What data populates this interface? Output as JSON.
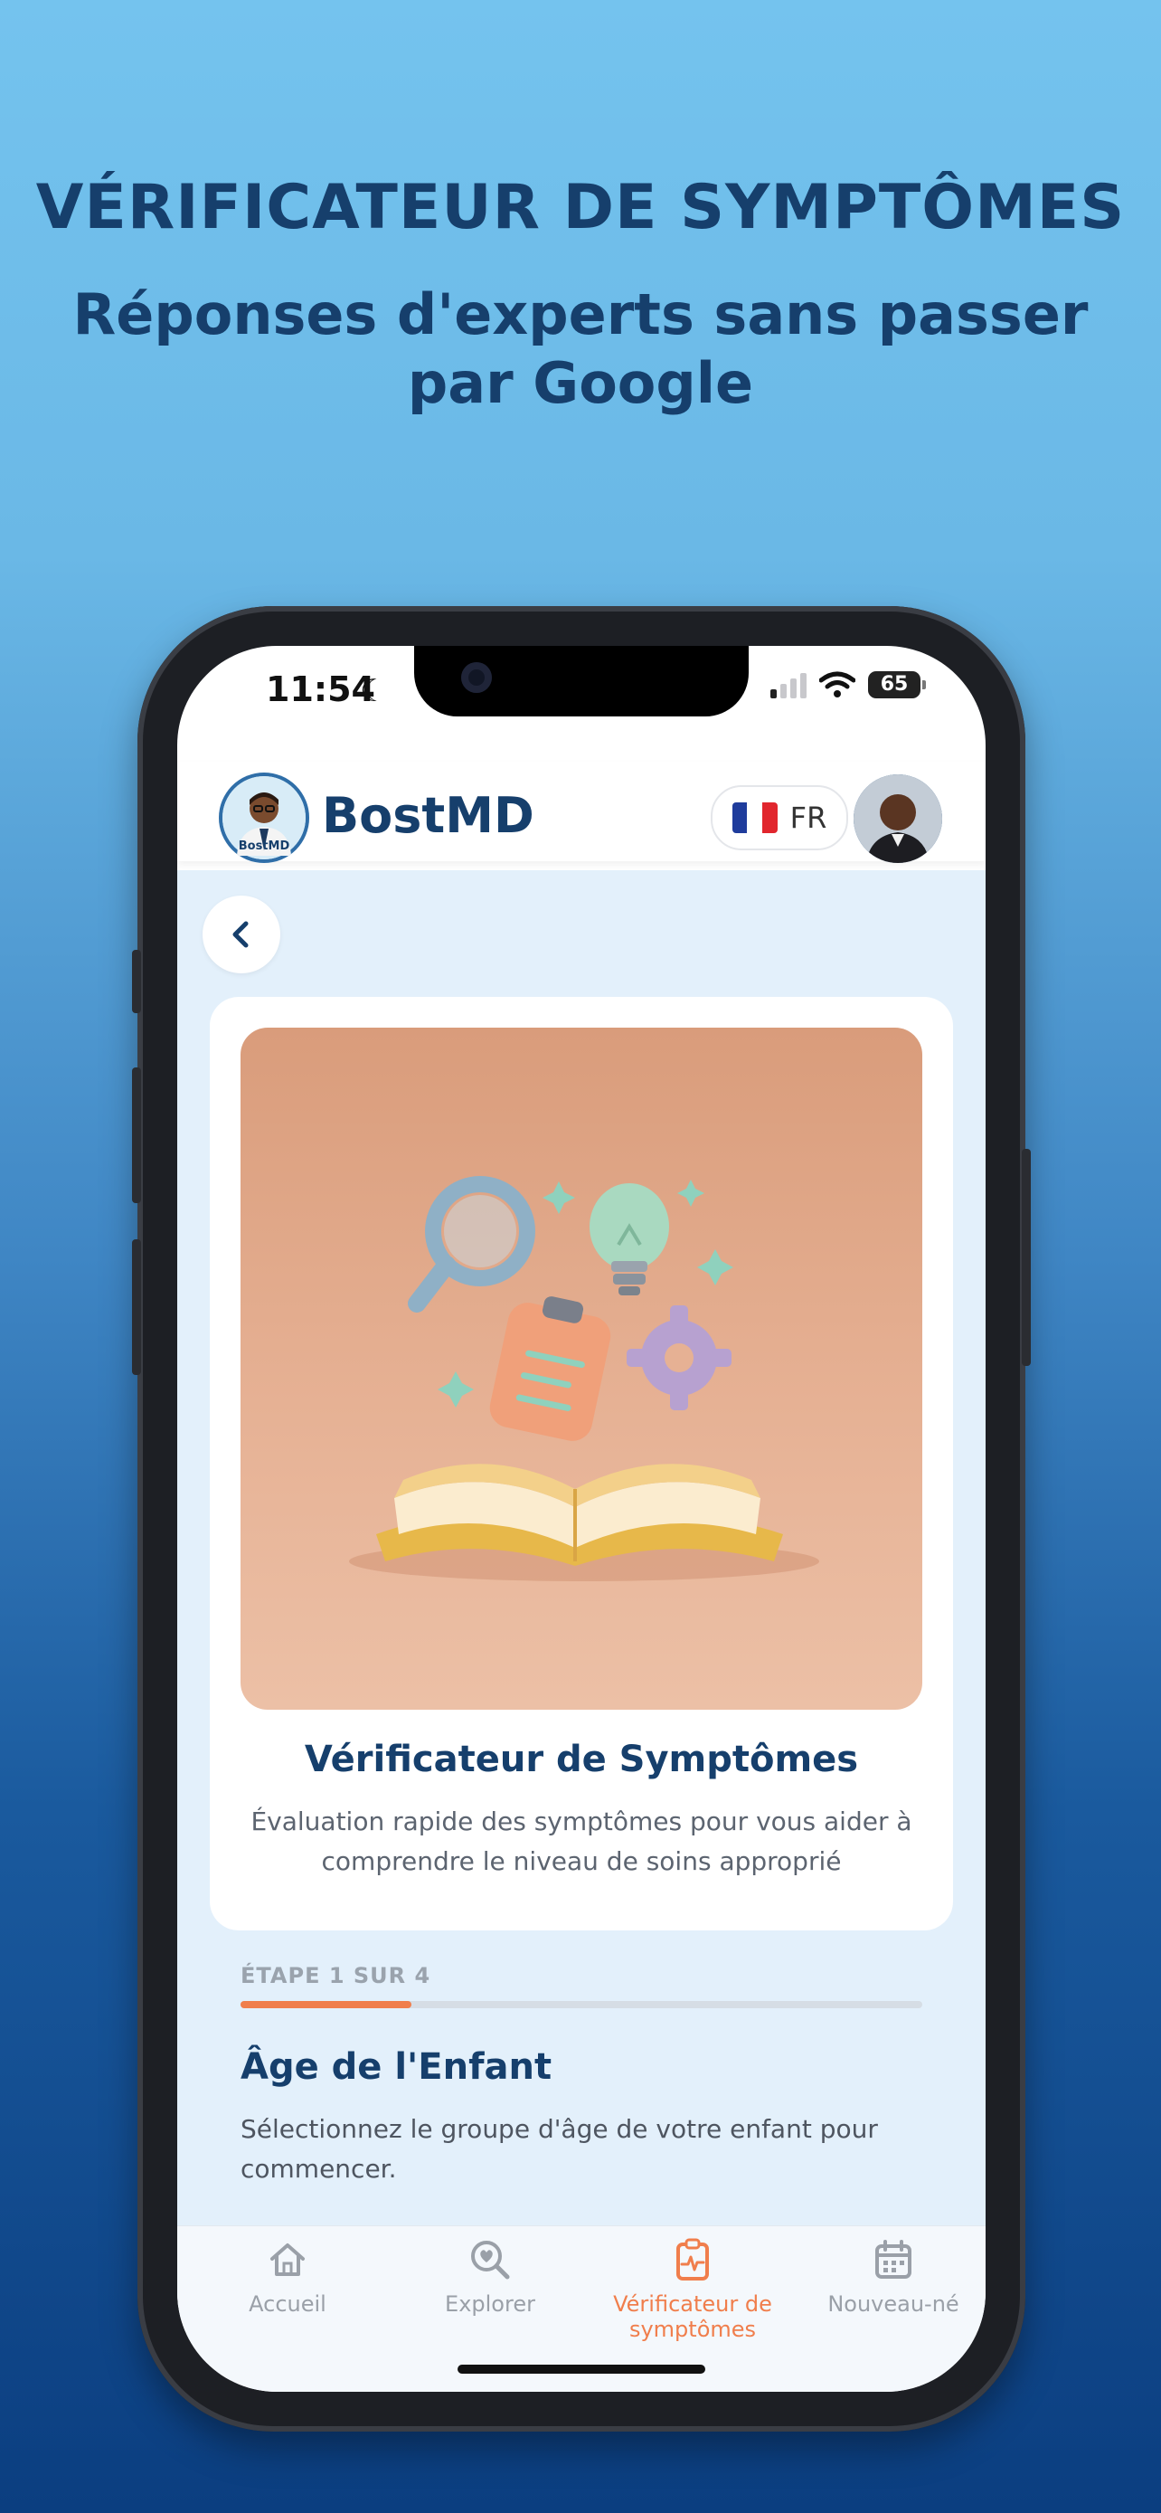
{
  "promo": {
    "headline": "VÉRIFICATEUR DE SYMPTÔMES",
    "subheadline": "Réponses d'experts sans passer par Google"
  },
  "status_bar": {
    "time": "11:54",
    "battery": "65"
  },
  "header": {
    "brand": "BostMD",
    "logo_caption": "BostMD",
    "language_code": "FR"
  },
  "card": {
    "title": "Vérificateur de Symptômes",
    "description": "Évaluation rapide des symptômes pour vous aider à comprendre le niveau de soins approprié"
  },
  "step": {
    "label": "ÉTAPE 1 SUR 4",
    "progress_fraction": 0.25
  },
  "section": {
    "title": "Âge de l'Enfant",
    "description": "Sélectionnez le groupe d'âge de votre enfant pour commencer."
  },
  "nav": {
    "items": [
      {
        "label": "Accueil",
        "icon": "home-icon"
      },
      {
        "label": "Explorer",
        "icon": "explore-heart-search-icon"
      },
      {
        "label": "Vérificateur de symptômes",
        "icon": "clipboard-pulse-icon"
      },
      {
        "label": "Nouveau-né",
        "icon": "calendar-icon"
      }
    ],
    "active_index": 2
  },
  "colors": {
    "brand_navy": "#163f6c",
    "accent_orange": "#f07e4c",
    "content_background": "#e3f0fb"
  }
}
